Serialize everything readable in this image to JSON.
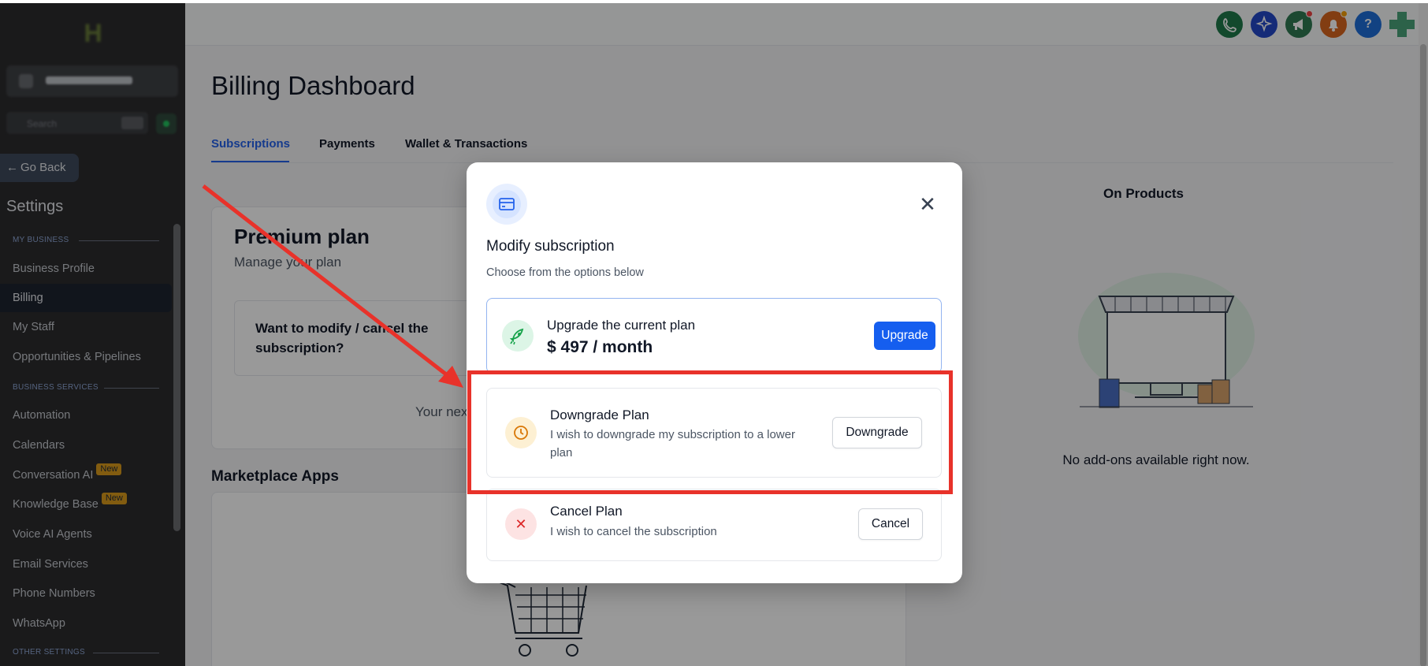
{
  "sidebar": {
    "go_back": "Go Back",
    "settings_title": "Settings",
    "sections": {
      "my_business": "MY BUSINESS",
      "business_services": "BUSINESS SERVICES",
      "other_settings": "OTHER SETTINGS"
    },
    "items": [
      {
        "label": "Business Profile"
      },
      {
        "label": "Billing",
        "active": true
      },
      {
        "label": "My Staff"
      },
      {
        "label": "Opportunities & Pipelines"
      },
      {
        "label": "Automation"
      },
      {
        "label": "Calendars"
      },
      {
        "label": "Conversation AI",
        "badge": "New"
      },
      {
        "label": "Knowledge Base",
        "badge": "New"
      },
      {
        "label": "Voice AI Agents"
      },
      {
        "label": "Email Services"
      },
      {
        "label": "Phone Numbers"
      },
      {
        "label": "WhatsApp"
      }
    ],
    "search_placeholder": "Search"
  },
  "topbar": {
    "icons": [
      {
        "name": "phone-icon",
        "color": "#1f7a4a"
      },
      {
        "name": "ai-sparkle-icon",
        "color": "#2348c9"
      },
      {
        "name": "megaphone-icon",
        "color": "#2f7a52"
      },
      {
        "name": "bell-icon",
        "color": "#d9661f"
      },
      {
        "name": "help-icon",
        "color": "#1e6fd9",
        "glyph": "?"
      }
    ]
  },
  "page": {
    "title": "Billing Dashboard",
    "tabs": [
      "Subscriptions",
      "Payments",
      "Wallet & Transactions"
    ],
    "plan": {
      "title": "Premium plan",
      "subtitle": "Manage your plan",
      "modify_prompt": "Want to modify / cancel the subscription?",
      "next_text": "Your nex"
    },
    "marketplace_title": "Marketplace Apps",
    "addons_title": "On Products",
    "addons_empty": "No add-ons available right now."
  },
  "modal": {
    "title": "Modify subscription",
    "subtitle": "Choose from the options below",
    "options": {
      "upgrade": {
        "title": "Upgrade the current plan",
        "price": "$ 497 / month",
        "button": "Upgrade"
      },
      "downgrade": {
        "title": "Downgrade Plan",
        "description": "I wish to downgrade my subscription to a lower plan",
        "button": "Downgrade"
      },
      "cancel": {
        "title": "Cancel Plan",
        "description": "I wish to cancel the subscription",
        "button": "Cancel"
      }
    }
  },
  "colors": {
    "accent": "#155eef",
    "highlight": "#e8322a",
    "badge": "#d99a1b"
  }
}
